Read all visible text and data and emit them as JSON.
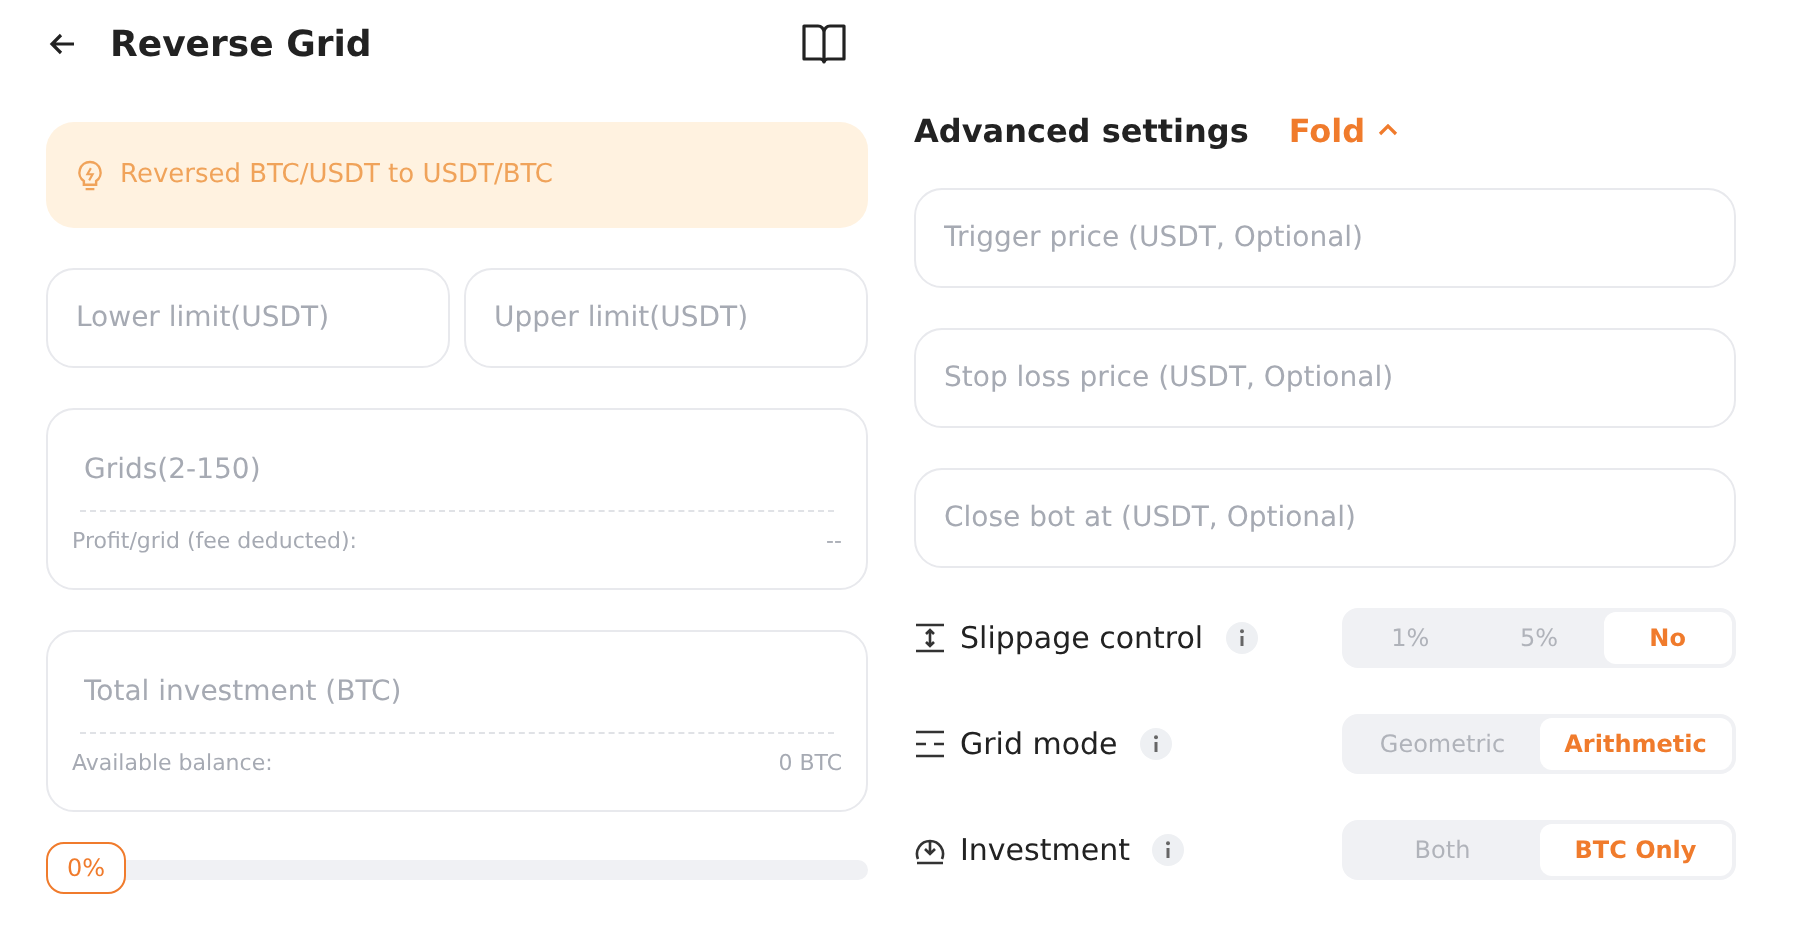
{
  "header": {
    "title": "Reverse Grid"
  },
  "tip": "Reversed BTC/USDT to USDT/BTC",
  "limits": [
    {
      "placeholder": "Lower limit(USDT)"
    },
    {
      "placeholder": "Upper limit(USDT)"
    }
  ],
  "grids": {
    "placeholder": "Grids(2-150)",
    "info_label": "Profit/grid (fee deducted):",
    "info_value": "--"
  },
  "investment": {
    "placeholder": "Total investment (BTC)",
    "info_label": "Available balance:",
    "info_value": "0 BTC"
  },
  "slider": {
    "label": "0%",
    "level": 0
  },
  "advanced": {
    "title": "Advanced settings",
    "toggle": "Fold",
    "expanded": true
  },
  "optional_fields": [
    {
      "placeholder": "Trigger price (USDT, Optional)"
    },
    {
      "placeholder": "Stop loss price (USDT, Optional)"
    },
    {
      "placeholder": "Close bot at (USDT, Optional)"
    }
  ],
  "options": [
    {
      "label": "Slippage control",
      "choices": [
        {
          "label": "1%",
          "selected": false
        },
        {
          "label": "5%",
          "selected": false
        },
        {
          "label": "No",
          "selected": true
        }
      ]
    },
    {
      "label": "Grid mode",
      "choices": [
        {
          "label": "Geometric",
          "selected": false
        },
        {
          "label": "Arithmetic",
          "selected": true
        }
      ]
    },
    {
      "label": "Investment",
      "choices": [
        {
          "label": "Both",
          "selected": false
        },
        {
          "label": "BTC Only",
          "selected": true
        }
      ]
    }
  ]
}
